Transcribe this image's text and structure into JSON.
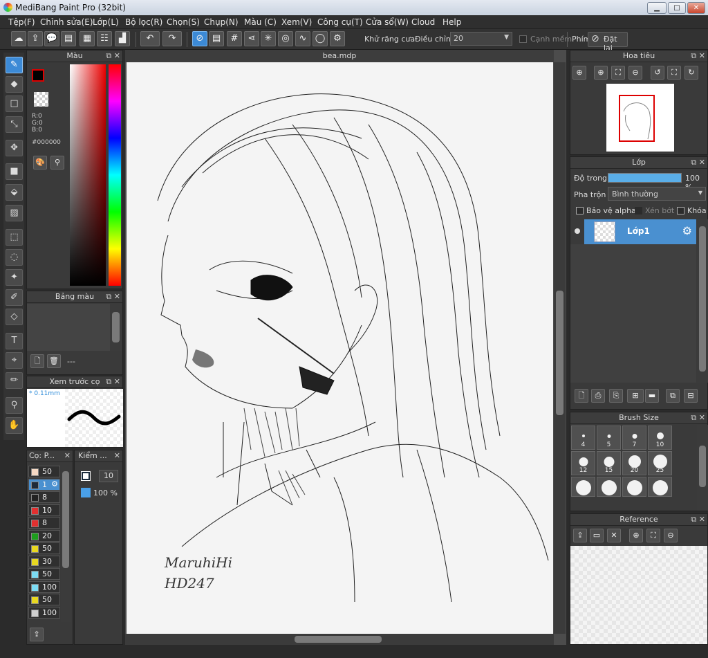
{
  "window": {
    "title": "MediBang Paint Pro (32bit)",
    "min_btn": "▁",
    "max_btn": "□",
    "close_btn": "✕"
  },
  "menu": [
    "Tệp(F)",
    "Chỉnh sửa(E)",
    "Lớp(L)",
    "Bộ lọc(R)",
    "Chọn(S)",
    "Chụp(N)",
    "Màu (C)",
    "Xem(V)",
    "Công cụ(T)",
    "Cửa sổ(W)",
    "Cloud",
    "Help"
  ],
  "toolbar": {
    "antialias_label": "Khử răng cưa",
    "adjust_label": "Điều chỉnh",
    "adjust_value": "20",
    "soft_edge_label": "Cạnh mềm",
    "key_label": "Phím",
    "reset_label": "Đặt lại"
  },
  "color_panel": {
    "title": "Màu",
    "r": "R:0",
    "g": "G:0",
    "b": "B:0",
    "hex": "#000000"
  },
  "palette_panel": {
    "title": "Bảng màu",
    "empty": "---"
  },
  "brush_preview": {
    "title": "Xem trước cọ",
    "size": "* 0.11mm"
  },
  "brush_list": {
    "tab1": "Cọ: P...",
    "tab2": "Kiểm ...",
    "items": [
      {
        "value": "50",
        "color": "#f6d9c4"
      },
      {
        "value": "1",
        "color": "#1e2a3a"
      },
      {
        "value": "8",
        "color": "#222222"
      },
      {
        "value": "10",
        "color": "#e23030"
      },
      {
        "value": "8",
        "color": "#e23030"
      },
      {
        "value": "20",
        "color": "#1d9e1d"
      },
      {
        "value": "50",
        "color": "#e8d820"
      },
      {
        "value": "30",
        "color": "#e8d820"
      },
      {
        "value": "50",
        "color": "#7cdcf4"
      },
      {
        "value": "100",
        "color": "#7cdcf4"
      },
      {
        "value": "50",
        "color": "#e8d820"
      },
      {
        "value": "100",
        "color": "#cfcfcf"
      }
    ]
  },
  "check_panel": {
    "size": "10",
    "opacity": "100 %"
  },
  "document": {
    "tab": "bea.mdp",
    "signature_line1": "MaruhiHi",
    "signature_line2": "HD247"
  },
  "navigator": {
    "title": "Hoa tiêu"
  },
  "layer_panel": {
    "title": "Lớp",
    "opacity_label": "Độ trong",
    "opacity_value": "100 %",
    "opacity_fraction": 1.0,
    "blend_label": "Pha trộn",
    "blend_value": "Bình thường",
    "protect_alpha": "Bảo vệ alpha",
    "clip": "Xén bớt",
    "lock": "Khóa",
    "layer_name": "Lớp1"
  },
  "brush_size": {
    "title": "Brush Size",
    "sizes": [
      "4",
      "5",
      "7",
      "10",
      "12",
      "15",
      "20",
      "25"
    ]
  },
  "reference": {
    "title": "Reference"
  },
  "colors": {
    "accent": "#3c8ad6",
    "layer_selected": "#4a90d0"
  }
}
